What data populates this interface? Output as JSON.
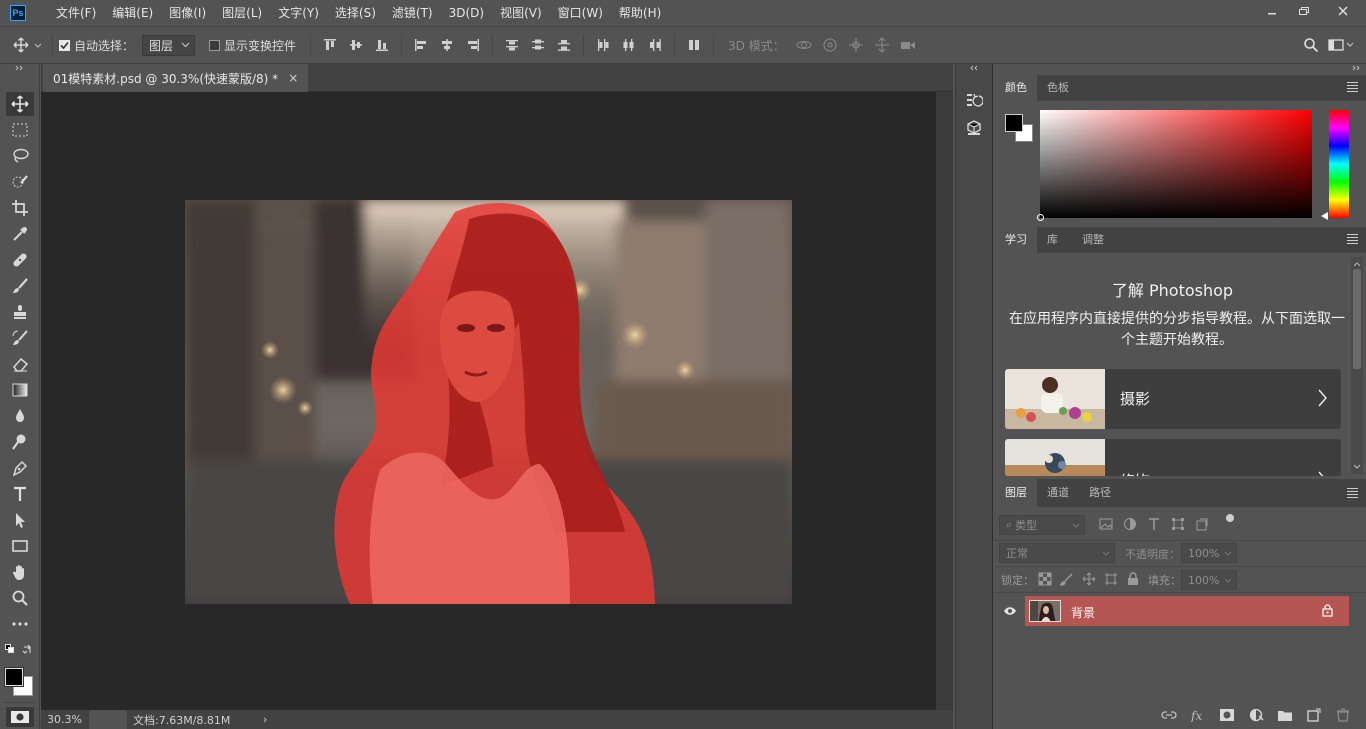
{
  "app": {
    "logo": "Ps"
  },
  "menu": [
    "文件(F)",
    "编辑(E)",
    "图像(I)",
    "图层(L)",
    "文字(Y)",
    "选择(S)",
    "滤镜(T)",
    "3D(D)",
    "视图(V)",
    "窗口(W)",
    "帮助(H)"
  ],
  "options": {
    "auto_select_label": "自动选择：",
    "auto_select_target": "图层",
    "show_transform_label": "显示变换控件",
    "mode_3d_label": "3D 模式："
  },
  "document": {
    "tab_title": "01模特素材.psd @ 30.3%(快速蒙版/8) *",
    "tab_close": "×",
    "zoom": "30.3%",
    "doc_info": "文档:7.63M/8.81M",
    "status_arrow": "›"
  },
  "panels": {
    "color_tabs": [
      "颜色",
      "色板"
    ],
    "learn_tabs": [
      "学习",
      "库",
      "调整"
    ],
    "learn_title": "了解 Photoshop",
    "learn_desc": "在应用程序内直接提供的分步指导教程。从下面选取一个主题开始教程。",
    "learn_cards": [
      "摄影",
      "修饰"
    ],
    "layers_tabs": [
      "图层",
      "通道",
      "路径"
    ],
    "layer_filter": "类型",
    "blend_mode": "正常",
    "opacity_label": "不透明度：",
    "opacity_value": "100%",
    "lock_label": "锁定：",
    "fill_label": "填充：",
    "fill_value": "100%",
    "layers": [
      {
        "name": "背景",
        "visible": true,
        "locked": true
      }
    ]
  },
  "colors": {
    "quickmask_overlay": "#e53a34",
    "selected_layer_bg": "#b55652",
    "foreground": "#000000",
    "background": "#ffffff"
  }
}
